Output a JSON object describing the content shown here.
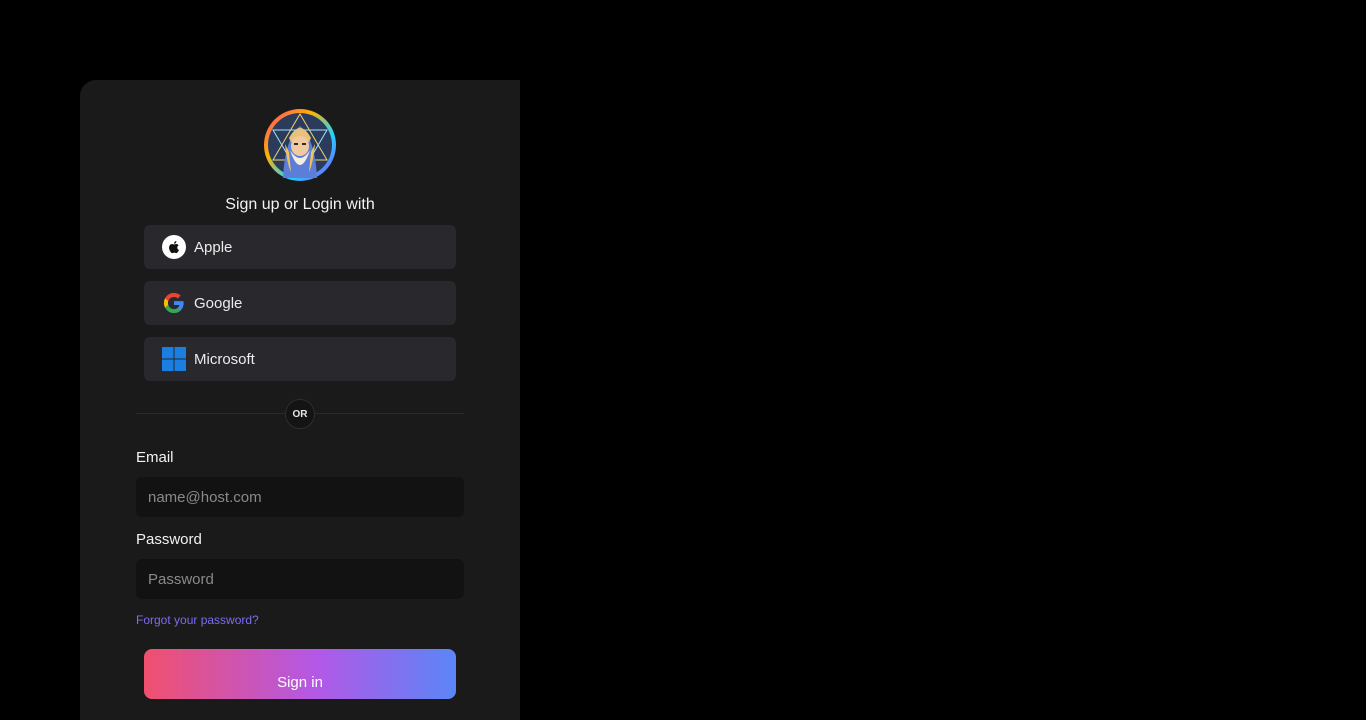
{
  "auth": {
    "heading": "Sign up or Login with",
    "providers": [
      {
        "label": "Apple",
        "icon": "apple-icon"
      },
      {
        "label": "Google",
        "icon": "google-icon"
      },
      {
        "label": "Microsoft",
        "icon": "microsoft-icon"
      }
    ],
    "divider_text": "OR",
    "email": {
      "label": "Email",
      "placeholder": "name@host.com",
      "value": ""
    },
    "password": {
      "label": "Password",
      "placeholder": "Password",
      "value": ""
    },
    "forgot_link": "Forgot your password?",
    "submit_label": "Sign in"
  },
  "colors": {
    "page_bg": "#000000",
    "card_bg": "#1a1a1b",
    "button_bg": "#28282d",
    "input_bg": "#121213",
    "link": "#7b6cf0",
    "gradient_start": "#f0506e",
    "gradient_mid": "#b358e6",
    "gradient_end": "#5b86f7"
  }
}
